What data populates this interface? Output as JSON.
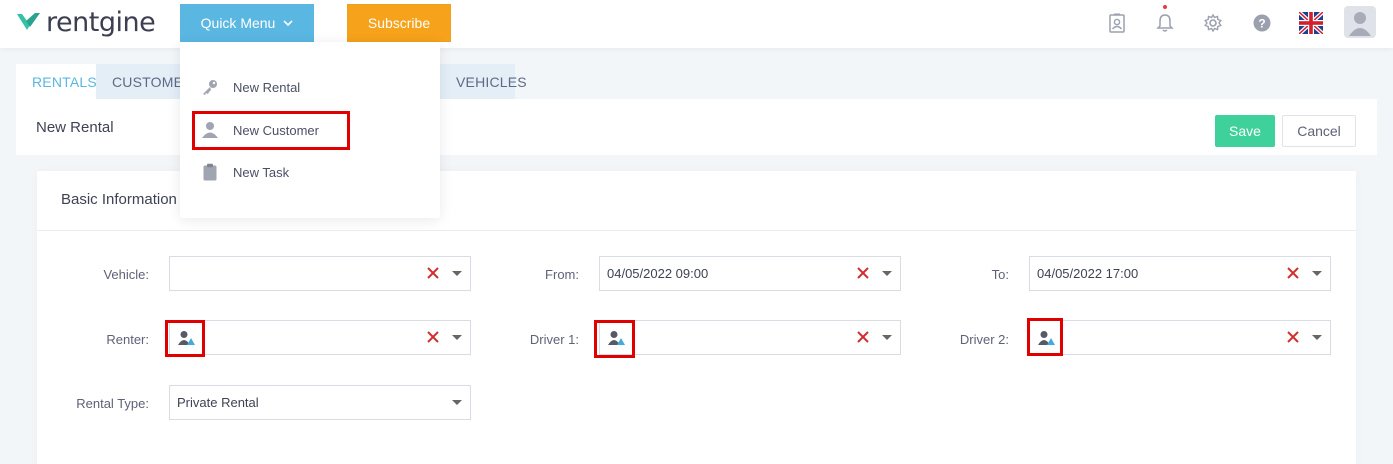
{
  "brand": {
    "name": "rentgine",
    "accent": "#5ab7e2",
    "mark_color": "#34c1a6"
  },
  "header": {
    "quick_menu_label": "Quick Menu",
    "subscribe_label": "Subscribe",
    "icons": [
      "contacts-icon",
      "bell-icon",
      "gear-icon",
      "help-icon",
      "uk-flag-icon",
      "user-avatar-icon"
    ]
  },
  "quick_menu": {
    "items": [
      {
        "label": "New Rental",
        "icon": "key-icon"
      },
      {
        "label": "New Customer",
        "icon": "user-icon"
      },
      {
        "label": "New Task",
        "icon": "clipboard-icon"
      }
    ]
  },
  "tabs": [
    {
      "label": "RENTALS",
      "active": true
    },
    {
      "label": "CUSTOMERS",
      "active": false
    },
    {
      "label": "VEHICLES",
      "active": false
    }
  ],
  "page": {
    "title": "New Rental",
    "save_label": "Save",
    "cancel_label": "Cancel"
  },
  "basic_info": {
    "title": "Basic Information",
    "fields": {
      "vehicle": {
        "label": "Vehicle:",
        "value": ""
      },
      "from": {
        "label": "From:",
        "value": "04/05/2022 09:00"
      },
      "to": {
        "label": "To:",
        "value": "04/05/2022 17:00"
      },
      "renter": {
        "label": "Renter:",
        "value": ""
      },
      "driver1": {
        "label": "Driver 1:",
        "value": ""
      },
      "driver2": {
        "label": "Driver 2:",
        "value": ""
      },
      "rental_type": {
        "label": "Rental Type:",
        "value": "Private Rental"
      }
    }
  },
  "colors": {
    "save": "#3fd19b",
    "subscribe": "#f6a21a",
    "highlight": "#e00000",
    "clear_x": "#d32f2f"
  }
}
